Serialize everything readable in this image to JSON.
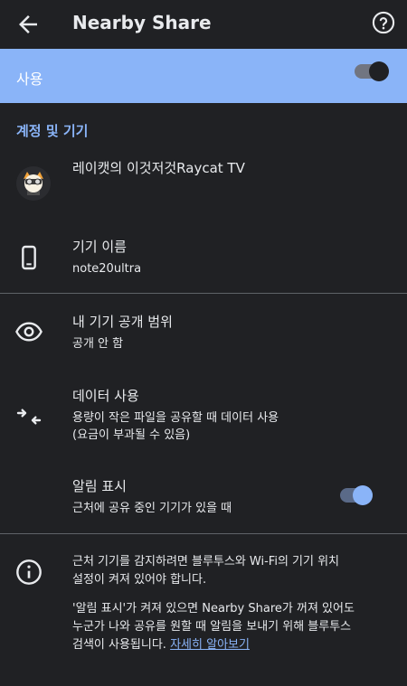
{
  "appbar": {
    "title": "Nearby Share"
  },
  "master": {
    "label": "사용",
    "on": true
  },
  "section": {
    "title": "계정 및 기기"
  },
  "account": {
    "name": "레이캣의 이것저것Raycat TV"
  },
  "device": {
    "title": "기기 이름",
    "value": "note20ultra"
  },
  "visibility": {
    "title": "내 기기 공개 범위",
    "value": "공개 안 함"
  },
  "data_usage": {
    "title": "데이터 사용",
    "line1": "용량이 작은 파일을 공유할 때 데이터 사용",
    "line2": "(요금이 부과될 수 있음)"
  },
  "notification": {
    "title": "알림 표시",
    "sub": "근처에 공유 중인 기기가 있을 때",
    "on": true
  },
  "info": {
    "para1_line1": "근처 기기를 감지하려면 블루투스와 Wi-Fi의 기기 위치",
    "para1_line2": "설정이 켜져 있어야 합니다.",
    "para2_line1": "'알림 표시'가 켜져 있으면 Nearby Share가 꺼져 있어도",
    "para2_line2": "누군가 나와 공유를 원할 때 알림을 보내기 위해 블루투스",
    "para2_line3": "검색이 사용됩니다.",
    "link": "자세히 알아보기"
  },
  "colors": {
    "accent": "#8ab4f8",
    "background": "#202124",
    "toggle_thumb_master": "#202124"
  }
}
